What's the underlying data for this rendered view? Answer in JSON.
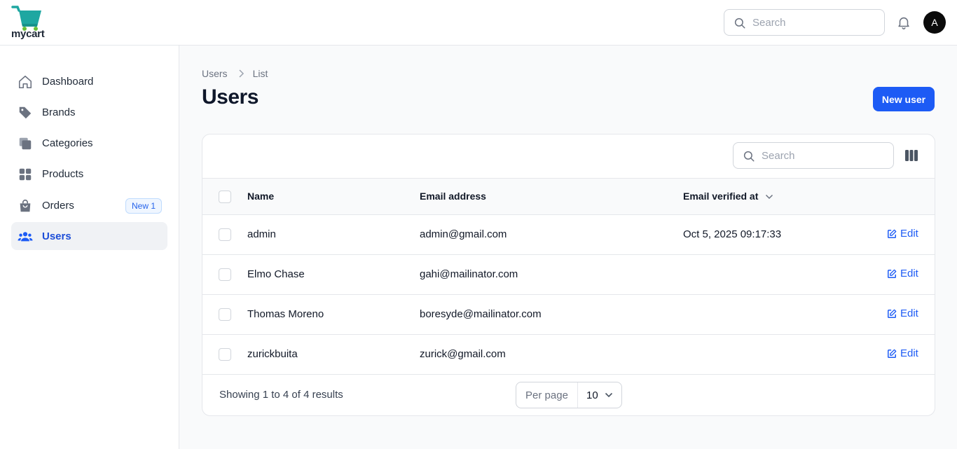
{
  "app": {
    "name": "mycart"
  },
  "topbar": {
    "search_placeholder": "Search",
    "avatar_initial": "A"
  },
  "sidebar": {
    "items": [
      {
        "label": "Dashboard",
        "icon": "home-icon"
      },
      {
        "label": "Brands",
        "icon": "tag-icon"
      },
      {
        "label": "Categories",
        "icon": "layers-icon"
      },
      {
        "label": "Products",
        "icon": "grid-icon"
      },
      {
        "label": "Orders",
        "icon": "shopping-bag-icon",
        "badge": "New 1"
      },
      {
        "label": "Users",
        "icon": "users-icon",
        "active": true
      }
    ]
  },
  "breadcrumb": {
    "items": [
      "Users",
      "List"
    ]
  },
  "page": {
    "title": "Users",
    "new_button": "New user"
  },
  "table": {
    "search_placeholder": "Search",
    "columns": [
      "Name",
      "Email address",
      "Email verified at"
    ],
    "rows": [
      {
        "name": "admin",
        "email": "admin@gmail.com",
        "verified_at": "Oct 5, 2025 09:17:33",
        "action": "Edit"
      },
      {
        "name": "Elmo Chase",
        "email": "gahi@mailinator.com",
        "verified_at": "",
        "action": "Edit"
      },
      {
        "name": "Thomas Moreno",
        "email": "boresyde@mailinator.com",
        "verified_at": "",
        "action": "Edit"
      },
      {
        "name": "zurickbuita",
        "email": "zurick@gmail.com",
        "verified_at": "",
        "action": "Edit"
      }
    ],
    "footer": {
      "summary": "Showing 1 to 4 of 4 results",
      "per_page_label": "Per page",
      "per_page_value": "10"
    }
  },
  "colors": {
    "accent": "#1d5bf5",
    "logo_teal": "#1ea7a1",
    "logo_green": "#6bbf3a"
  }
}
